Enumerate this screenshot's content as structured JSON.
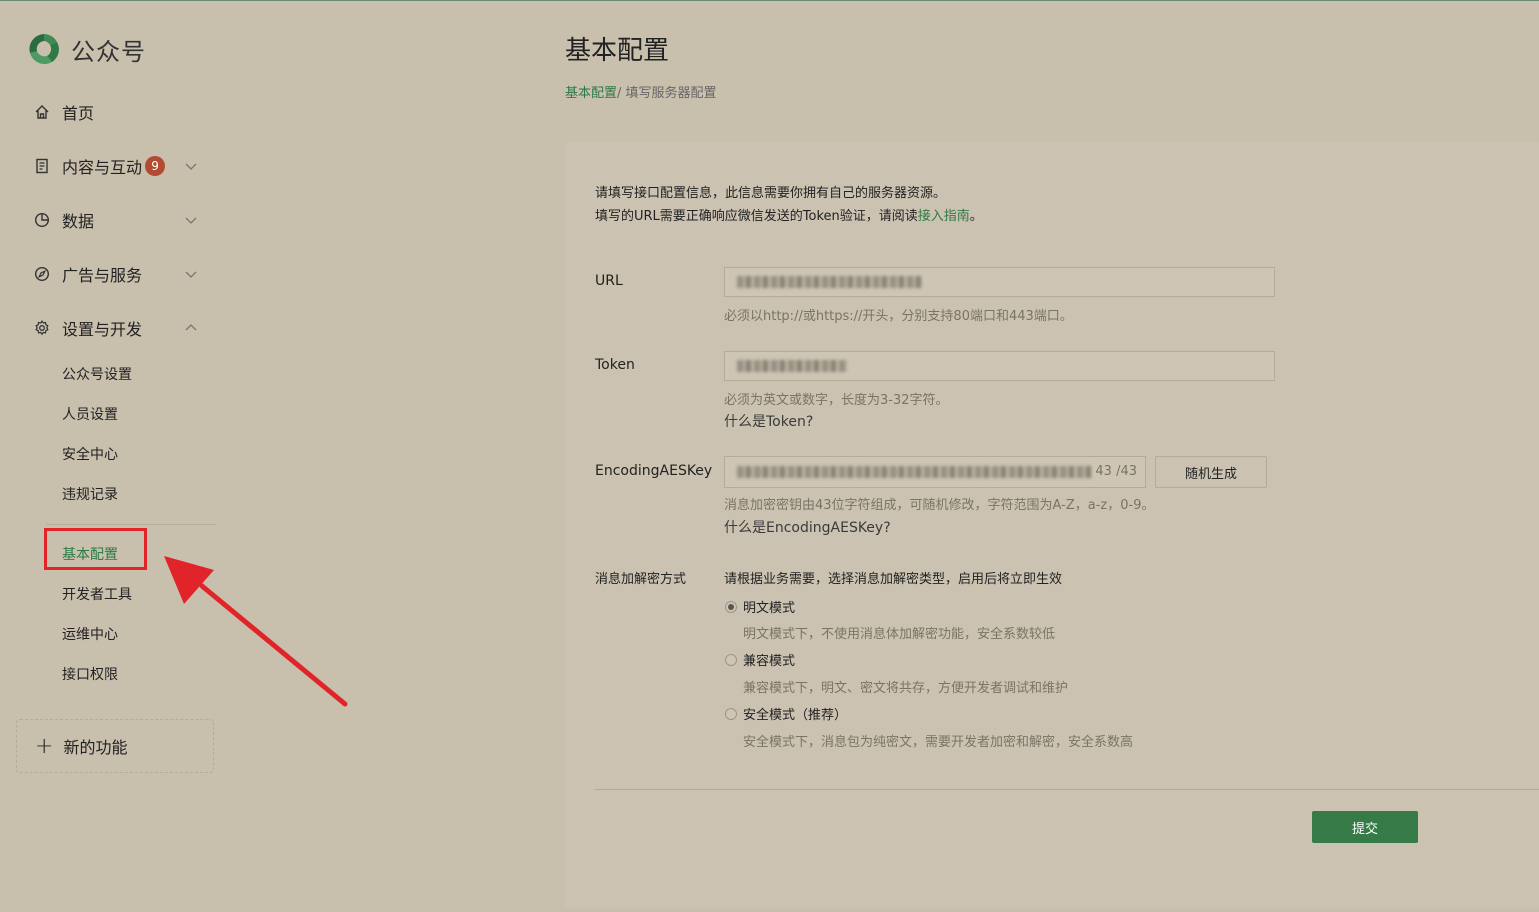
{
  "app": {
    "name": "公众号"
  },
  "nav": [
    {
      "label": "首页",
      "icon": "home-icon"
    },
    {
      "label": "内容与互动",
      "icon": "document-icon",
      "badge": "9"
    },
    {
      "label": "数据",
      "icon": "chart-pie-icon"
    },
    {
      "label": "广告与服务",
      "icon": "compass-icon"
    },
    {
      "label": "设置与开发",
      "icon": "gear-icon"
    }
  ],
  "settings_sub": [
    "公众号设置",
    "人员设置",
    "安全中心",
    "违规记录"
  ],
  "dev_sub": [
    "基本配置",
    "开发者工具",
    "运维中心",
    "接口权限"
  ],
  "new_feature": "新的功能",
  "page": {
    "title": "基本配置",
    "breadcrumb": {
      "link": "基本配置",
      "sep": "/ ",
      "current": "填写服务器配置"
    }
  },
  "form": {
    "intro_line1": "请填写接口配置信息，此信息需要你拥有自己的服务器资源。",
    "intro_line2_pre": "填写的URL需要正确响应微信发送的Token验证，请阅读",
    "intro_link": "接入指南",
    "intro_line2_post": "。",
    "url": {
      "label": "URL",
      "hint": "必须以http://或https://开头，分别支持80端口和443端口。"
    },
    "token": {
      "label": "Token",
      "hint": "必须为英文或数字，长度为3-32字符。",
      "help": "什么是Token?"
    },
    "aes": {
      "label": "EncodingAESKey",
      "counter": "43 /43",
      "button": "随机生成",
      "hint": "消息加密密钥由43位字符组成，可随机修改，字符范围为A-Z，a-z，0-9。",
      "help": "什么是EncodingAESKey?"
    },
    "mode": {
      "label": "消息加解密方式",
      "desc": "请根据业务需要，选择消息加解密类型，启用后将立即生效",
      "options": [
        {
          "label": "明文模式",
          "desc": "明文模式下，不使用消息体加解密功能，安全系数较低",
          "checked": true
        },
        {
          "label": "兼容模式",
          "desc": "兼容模式下，明文、密文将共存，方便开发者调试和维护",
          "checked": false
        },
        {
          "label": "安全模式（推荐）",
          "desc": "安全模式下，消息包为纯密文，需要开发者加密和解密，安全系数高",
          "checked": false
        }
      ]
    },
    "submit": "提交"
  },
  "colors": {
    "accent": "#2e7a44",
    "badge": "#b34b34",
    "highlight": "#e1242a",
    "submit_bg": "#357a47"
  }
}
